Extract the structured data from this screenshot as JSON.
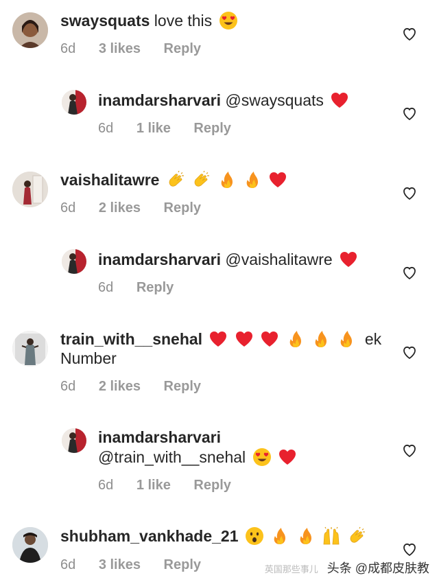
{
  "comments": [
    {
      "username": "swaysquats",
      "text": "love this",
      "emojis": [
        "heart-eyes"
      ],
      "time": "6d",
      "likes": "3 likes",
      "reply": "Reply"
    },
    {
      "username": "inamdarsharvari",
      "text": "@swaysquats",
      "emojis": [
        "red-heart"
      ],
      "time": "6d",
      "likes": "1 like",
      "reply": "Reply"
    },
    {
      "username": "vaishalitawre",
      "text": "",
      "emojis": [
        "clapping-hands",
        "clapping-hands",
        "fire",
        "fire",
        "red-heart"
      ],
      "time": "6d",
      "likes": "2 likes",
      "reply": "Reply"
    },
    {
      "username": "inamdarsharvari",
      "text": "@vaishalitawre",
      "emojis": [
        "red-heart"
      ],
      "time": "6d",
      "likes": "",
      "reply": "Reply"
    },
    {
      "username": "train_with__snehal",
      "text": "",
      "emojis": [
        "red-heart",
        "red-heart",
        "red-heart",
        "fire",
        "fire",
        "fire"
      ],
      "text_after": "ek",
      "second_line": "Number",
      "time": "6d",
      "likes": "2 likes",
      "reply": "Reply"
    },
    {
      "username": "inamdarsharvari",
      "second_line": "@train_with__snehal",
      "second_line_emojis": [
        "heart-eyes",
        "red-heart"
      ],
      "time": "6d",
      "likes": "1 like",
      "reply": "Reply"
    },
    {
      "username": "shubham_vankhade_21",
      "text": "",
      "emojis": [
        "astonished-face",
        "fire",
        "fire",
        "raising-hands",
        "clapping-hands"
      ],
      "time": "6d",
      "likes": "3 likes",
      "reply": "Reply"
    }
  ],
  "watermark": {
    "logo": "英国那些事儿",
    "text": "头条 @成都皮肤教"
  },
  "colors": {
    "username": "#262626",
    "meta": "#8e8e8e",
    "heart_red": "#e8212e",
    "fire_orange": "#f7931e"
  }
}
